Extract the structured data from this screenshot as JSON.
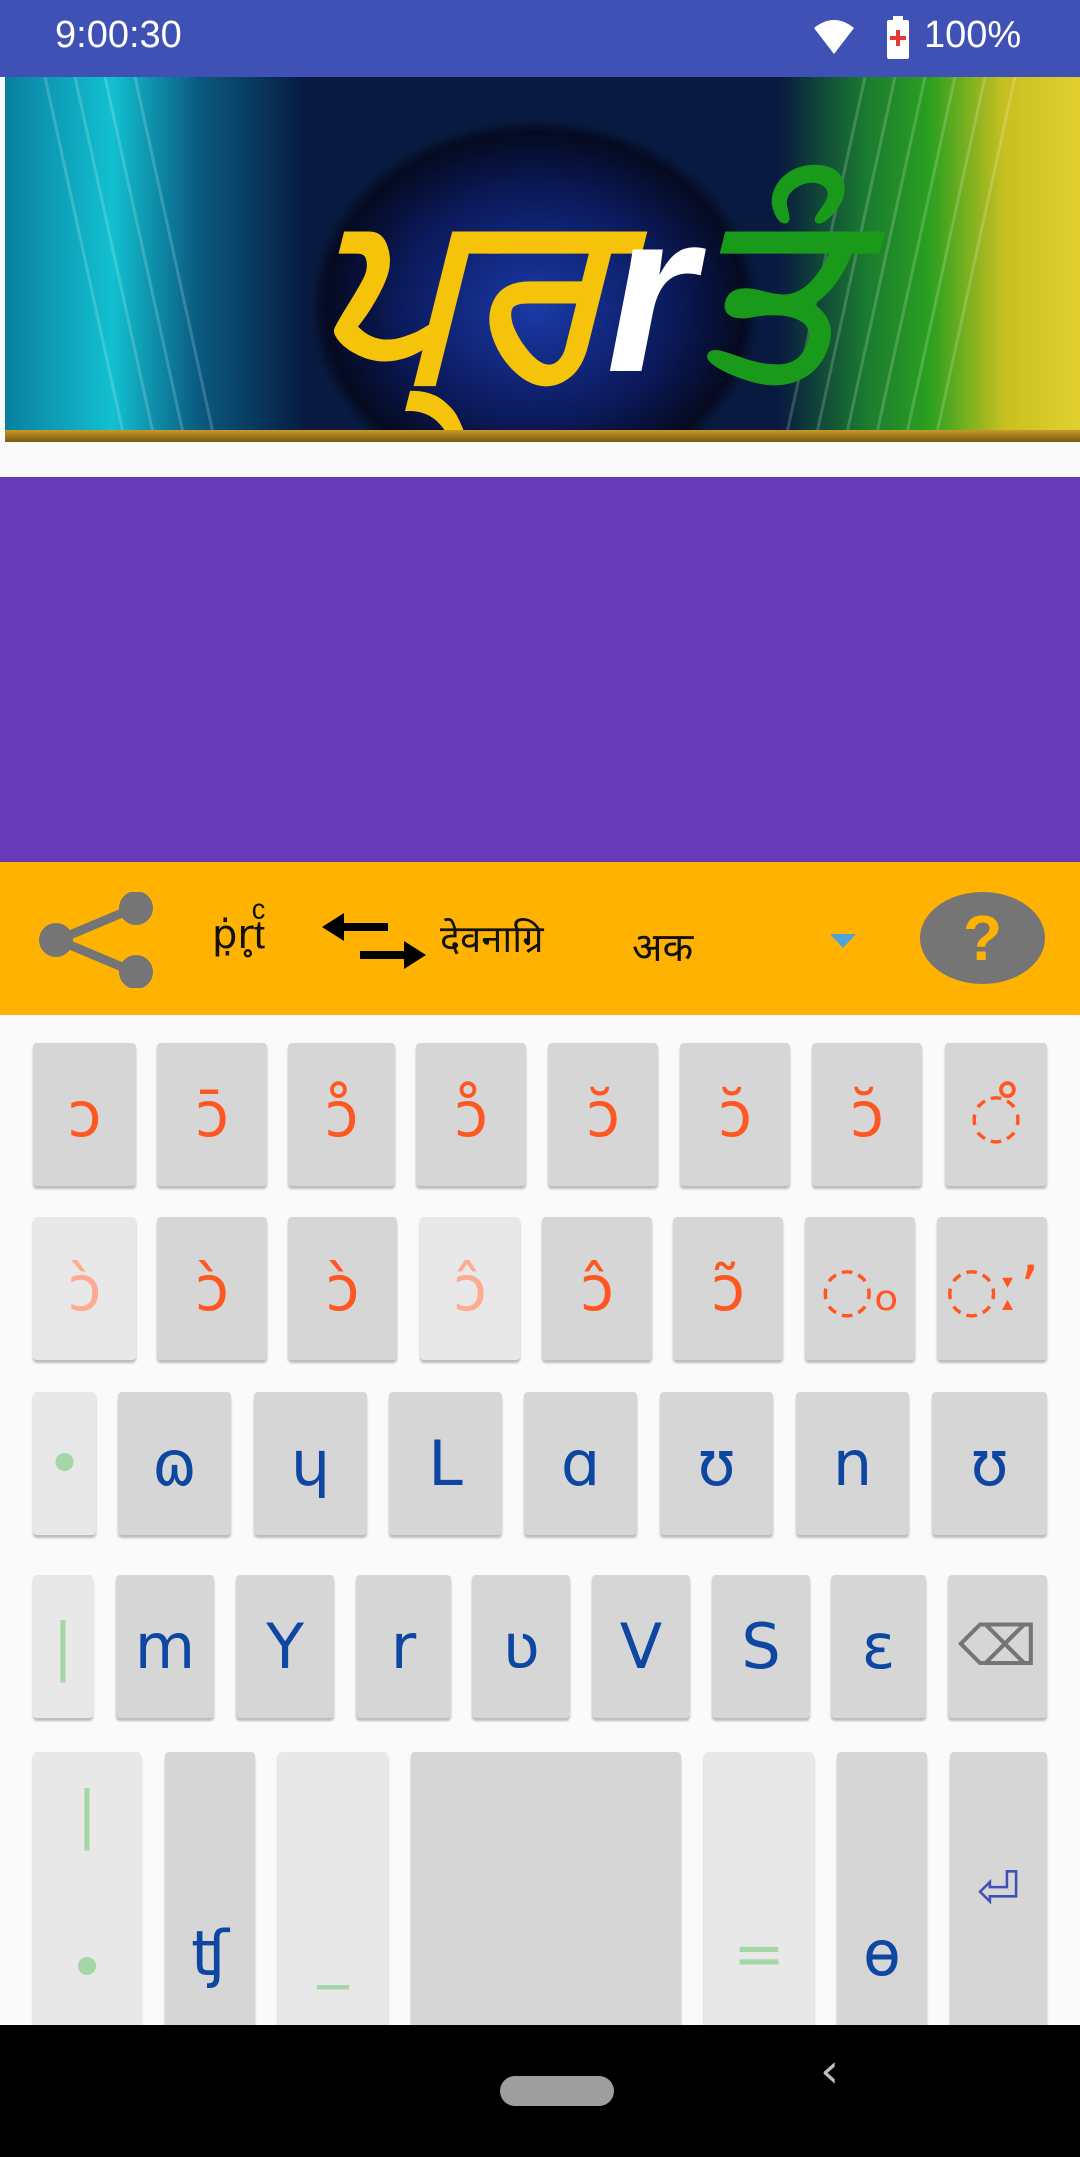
{
  "status_bar": {
    "time": "9:00:30",
    "battery": "100%",
    "bg_color": "#3f51b5"
  },
  "banner": {
    "logo_part1": "ਪ੍ਰ",
    "logo_part2": "r",
    "logo_part3": "ਤੰ"
  },
  "toolbar": {
    "bg_color": "#ffb300",
    "source_script": "ṗ̣r̥tͨ",
    "target_script": "देवनाग्रि",
    "dropdown_value": "अक",
    "help_label": "?"
  },
  "keyboard": {
    "row1": [
      "ɔ",
      "ɔ̄",
      "ɔ̊",
      "ɔ̊",
      "ɔ̆",
      "ɔ̆",
      "ɔ̆",
      "◌̊"
    ],
    "row2": [
      "ɔ̀",
      "ɔ̀",
      "ɔ̀",
      "ɔ̂",
      "ɔ̂",
      "ɔ̃",
      "◌ₒ",
      "◌ːʼ"
    ],
    "row3": [
      "•",
      "ɷ",
      "ɥ",
      "L",
      "ɑ",
      "ʊ",
      "n",
      "ʊ"
    ],
    "row4": [
      "|",
      "m",
      "Y",
      "r",
      "ʋ",
      "V",
      "S",
      "ɛ",
      "⌫"
    ],
    "row5": [
      "|",
      "•",
      "ʧ",
      "_",
      " ",
      "=",
      "ɵ",
      "⏎"
    ]
  },
  "navigation": {
    "back_label": "‹"
  }
}
